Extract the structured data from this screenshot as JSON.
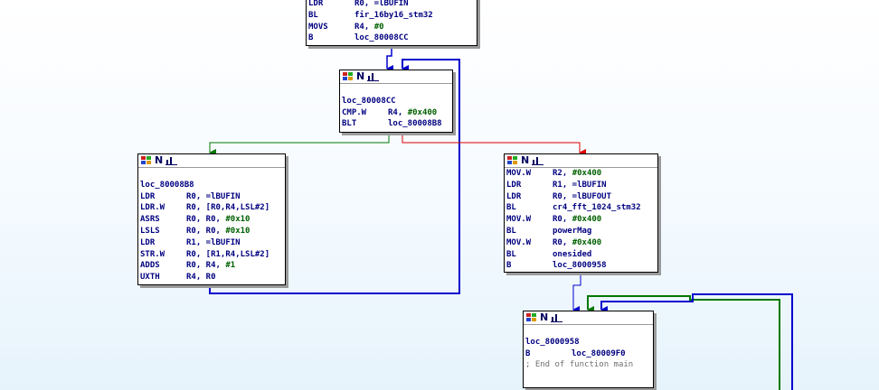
{
  "nodes": {
    "top": {
      "lines": [
        {
          "op": "LDR",
          "args": "R0, =lBUFIN"
        },
        {
          "op": "BL",
          "args": "fir_16by16_stm32"
        },
        {
          "op": "MOVS",
          "args": "R4, ",
          "num": "#0"
        },
        {
          "op": "B",
          "args": "loc_80008CC"
        }
      ]
    },
    "loop_cond": {
      "header_label": "N",
      "lines": [
        {
          "label": ""
        },
        {
          "label": "loc_80008CC"
        },
        {
          "op": "CMP.W",
          "args": "R4, ",
          "num": "#0x400"
        },
        {
          "op": "BLT",
          "args": "loc_80008B8"
        }
      ]
    },
    "loop_body": {
      "header_label": "N",
      "lines": [
        {
          "label": ""
        },
        {
          "label": "loc_80008B8"
        },
        {
          "op": "LDR",
          "args": "R0, =lBUFIN"
        },
        {
          "op": "LDR.W",
          "args": "R0, [R0,R4,LSL#2]"
        },
        {
          "op": "ASRS",
          "args": "R0, R0, ",
          "num": "#0x10"
        },
        {
          "op": "LSLS",
          "args": "R0, R0, ",
          "num": "#0x10"
        },
        {
          "op": "LDR",
          "args": "R1, =lBUFIN"
        },
        {
          "op": "STR.W",
          "args": "R0, [R1,R4,LSL#2]"
        },
        {
          "op": "ADDS",
          "args": "R0, R4, ",
          "num": "#1"
        },
        {
          "op": "UXTH",
          "args": "R4, R0"
        }
      ]
    },
    "fft_block": {
      "header_label": "N",
      "lines": [
        {
          "op": "MOV.W",
          "args": "R2, ",
          "num": "#0x400"
        },
        {
          "op": "LDR",
          "args": "R1, =lBUFIN"
        },
        {
          "op": "LDR",
          "args": "R0, =lBUFOUT"
        },
        {
          "op": "BL",
          "args": "cr4_fft_1024_stm32"
        },
        {
          "op": "MOV.W",
          "args": "R0, ",
          "num": "#0x400"
        },
        {
          "op": "BL",
          "args": "powerMag"
        },
        {
          "op": "MOV.W",
          "args": "R0, ",
          "num": "#0x400"
        },
        {
          "op": "BL",
          "args": "onesided"
        },
        {
          "op": "B",
          "args": "loc_8000958"
        }
      ]
    },
    "end_block": {
      "header_label": "N",
      "lines": [
        {
          "label": ""
        },
        {
          "label": "loc_8000958"
        },
        {
          "op": "B",
          "args": "loc_80009F0"
        },
        {
          "comment": "; End of function main"
        }
      ]
    }
  },
  "colors": {
    "edge_unconditional": "#0000cc",
    "edge_true": "#007700",
    "edge_false": "#dd0000",
    "code_text": "#000080",
    "immediate_value": "#006000",
    "comment_text": "#707070"
  }
}
